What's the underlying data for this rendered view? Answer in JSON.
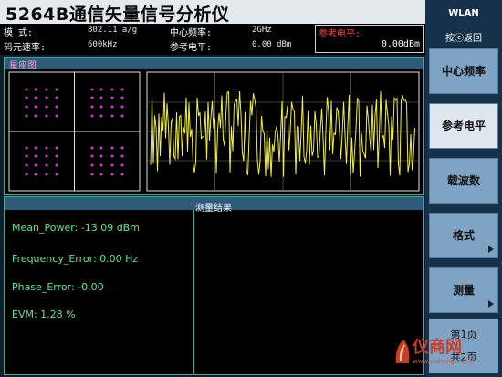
{
  "title": "5264B通信矢量信号分析仪",
  "info": {
    "mode_label": "模  式:",
    "mode_value": "802.11 a/g",
    "rate_label": "码元速率:",
    "rate_value": "600kHz",
    "center_label": "中心频率:",
    "center_value": "2GHz",
    "ref_label": "参考电平:",
    "ref_value": "0.00 dBm",
    "ref_box_label": "参考电平:",
    "ref_box_value": "0.00dBm"
  },
  "constellation": {
    "title": "星座图",
    "point_color": "#d23cd2"
  },
  "waveform": {
    "trace_color": "#f2f03a"
  },
  "measurement": {
    "title": "测量结果",
    "lines": [
      "Mean_Power: -13.09 dBm",
      "Frequency_Error: 0.00 Hz",
      "Phase_Error: -0.00",
      "EVM: 1.28 %"
    ]
  },
  "softkeys": {
    "mode": "WLAN",
    "back": "按ⓔ返回",
    "buttons": [
      {
        "label": "中心频率",
        "active": false,
        "arrow": false
      },
      {
        "label": "参考电平",
        "active": true,
        "arrow": false
      },
      {
        "label": "载波数",
        "active": false,
        "arrow": false
      },
      {
        "label": "格式",
        "active": false,
        "arrow": true
      },
      {
        "label": "测量",
        "active": false,
        "arrow": true
      }
    ],
    "page_line1": "第1页",
    "page_line2": "共2页"
  },
  "watermark": {
    "text": "仪商网",
    "url": "www.yishang.net.cn"
  }
}
